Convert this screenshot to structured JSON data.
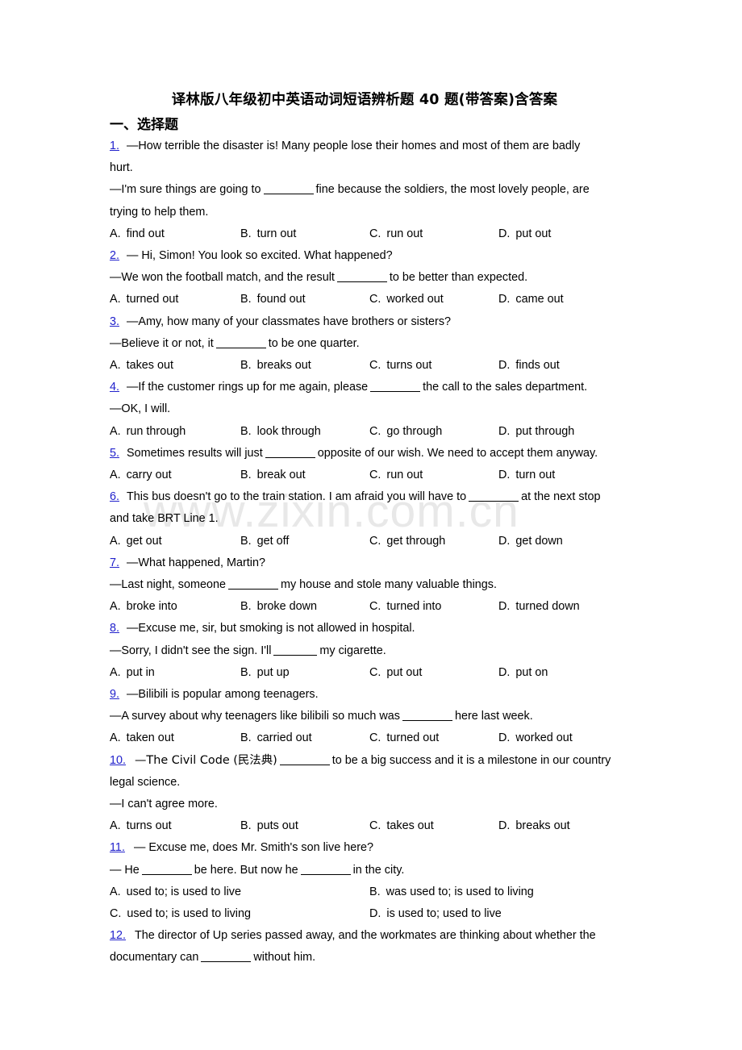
{
  "document": {
    "title": "译林版八年级初中英语动词短语辨析题 40 题(带答案)含答案",
    "section_heading": "一、选择题",
    "watermark": "www.zixin.com.cn"
  },
  "questions": [
    {
      "number": "1.",
      "lines": [
        "—How terrible the disaster is! Many people lose their homes and most of them are badly hurt.",
        "—I'm sure things are going to ________ fine because the soldiers, the most lovely people, are trying to help them."
      ],
      "stem_pre": "—I'm sure things are going to ",
      "stem_post": " fine because the soldiers, the most lovely people, are trying to help them.",
      "options_layout": "four",
      "options": [
        {
          "label": "A.",
          "text": "find out"
        },
        {
          "label": "B.",
          "text": "turn out"
        },
        {
          "label": "C.",
          "text": "run out"
        },
        {
          "label": "D.",
          "text": "put out"
        }
      ]
    },
    {
      "number": "2.",
      "lines": [
        "— Hi, Simon! You look so excited. What happened?",
        "—We won the football match, and the result ________ to be better than expected."
      ],
      "options_layout": "four",
      "options": [
        {
          "label": "A.",
          "text": "turned out"
        },
        {
          "label": "B.",
          "text": "found out"
        },
        {
          "label": "C.",
          "text": "worked out"
        },
        {
          "label": "D.",
          "text": "came out"
        }
      ]
    },
    {
      "number": "3.",
      "lines": [
        "—Amy, how many of your classmates have brothers or sisters?",
        "—Believe it or not, it ________ to be one quarter."
      ],
      "options_layout": "four",
      "options": [
        {
          "label": "A.",
          "text": "takes out"
        },
        {
          "label": "B.",
          "text": "breaks out"
        },
        {
          "label": "C.",
          "text": "turns out"
        },
        {
          "label": "D.",
          "text": "finds out"
        }
      ]
    },
    {
      "number": "4.",
      "lines": [
        "—If the customer rings up for me again, please ________ the call to the sales department.",
        "—OK, I will."
      ],
      "options_layout": "four",
      "options": [
        {
          "label": "A.",
          "text": "run through"
        },
        {
          "label": "B.",
          "text": "look through"
        },
        {
          "label": "C.",
          "text": "go through"
        },
        {
          "label": "D.",
          "text": "put through"
        }
      ]
    },
    {
      "number": "5.",
      "lines": [
        "Sometimes results will just ________ opposite of our wish. We need to accept them anyway."
      ],
      "options_layout": "four",
      "options": [
        {
          "label": "A.",
          "text": "carry out"
        },
        {
          "label": "B.",
          "text": "break out"
        },
        {
          "label": "C.",
          "text": "run out"
        },
        {
          "label": "D.",
          "text": "turn out"
        }
      ]
    },
    {
      "number": "6.",
      "lines": [
        "This bus doesn't go to the train station. I am afraid you will have to ________ at the next stop and take BRT Line 1."
      ],
      "options_layout": "four",
      "options": [
        {
          "label": "A.",
          "text": "get out"
        },
        {
          "label": "B.",
          "text": "get off"
        },
        {
          "label": "C.",
          "text": "get through"
        },
        {
          "label": "D.",
          "text": "get down"
        }
      ]
    },
    {
      "number": "7.",
      "lines": [
        "—What happened, Martin?",
        "—Last night, someone ________ my house and stole many valuable things."
      ],
      "options_layout": "four",
      "options": [
        {
          "label": "A.",
          "text": "broke into"
        },
        {
          "label": "B.",
          "text": "broke down"
        },
        {
          "label": "C.",
          "text": "turned into"
        },
        {
          "label": "D.",
          "text": "turned down"
        }
      ]
    },
    {
      "number": "8.",
      "lines": [
        "—Excuse me, sir, but smoking is not allowed in hospital.",
        "—Sorry, I didn't see the sign. I'll _______ my cigarette."
      ],
      "options_layout": "four",
      "options": [
        {
          "label": "A.",
          "text": "put in"
        },
        {
          "label": "B.",
          "text": "put up"
        },
        {
          "label": "C.",
          "text": "put out"
        },
        {
          "label": "D.",
          "text": "put on"
        }
      ]
    },
    {
      "number": "9.",
      "lines": [
        "—Bilibili is popular among teenagers.",
        "—A survey about why teenagers like bilibili so much was ________ here last week."
      ],
      "options_layout": "four",
      "options": [
        {
          "label": "A.",
          "text": "taken out"
        },
        {
          "label": "B.",
          "text": "carried out"
        },
        {
          "label": "C.",
          "text": "turned out"
        },
        {
          "label": "D.",
          "text": "worked out"
        }
      ]
    },
    {
      "number": "10.",
      "lines": [
        "—The Civil Code (民法典) ________ to be a big success and it is a milestone in our country legal science.",
        "—I can't agree more."
      ],
      "options_layout": "four",
      "options": [
        {
          "label": "A.",
          "text": "turns out"
        },
        {
          "label": "B.",
          "text": "puts out"
        },
        {
          "label": "C.",
          "text": "takes out"
        },
        {
          "label": "D.",
          "text": "breaks out"
        }
      ]
    },
    {
      "number": "11.",
      "lines": [
        "— Excuse me, does Mr. Smith's son live here?",
        "— He ________ be here. But now he ________ in the city."
      ],
      "options_layout": "two",
      "options": [
        {
          "label": "A.",
          "text": "used to; is used to live"
        },
        {
          "label": "B.",
          "text": "was used to; is used to living"
        },
        {
          "label": "C.",
          "text": "used to; is used to living"
        },
        {
          "label": "D.",
          "text": "is used to; used to live"
        }
      ]
    },
    {
      "number": "12.",
      "lines": [
        "The director of Up series passed away, and the workmates are thinking about whether the documentary can ________ without him."
      ],
      "options_layout": "none",
      "options": []
    }
  ],
  "text_fragments": {
    "q1_l1a": "—How terrible the disaster is! Many people lose their homes and most of them are badly",
    "q1_l1b": "hurt.",
    "q1_l2a": "—I'm sure things are going to",
    "q1_l2b": "fine because the soldiers, the most lovely people, are",
    "q1_l2c": "trying to help them.",
    "q2_l1": "— Hi, Simon! You look so excited. What happened?",
    "q2_l2a": "—We won the football match, and the result",
    "q2_l2b": "to be better than expected.",
    "q3_l1": "—Amy, how many of your classmates have brothers or sisters?",
    "q3_l2a": "—Believe it or not, it",
    "q3_l2b": "to be one quarter.",
    "q4_l1a": "—If the customer rings up for me again, please",
    "q4_l1b": "the call to the sales department.",
    "q4_l2": "—OK, I will.",
    "q5_l1a": "Sometimes results will just",
    "q5_l1b": "opposite of our wish. We need to accept them anyway.",
    "q6_l1a": "This bus doesn't go to the train station. I am afraid you will have to",
    "q6_l1b": "at the next stop",
    "q6_l2": "and take BRT Line 1.",
    "q7_l1": "—What happened, Martin?",
    "q7_l2a": "—Last night, someone",
    "q7_l2b": "my house and stole many valuable things.",
    "q8_l1": "—Excuse me, sir, but smoking is not allowed in hospital.",
    "q8_l2a": "—Sorry, I didn't see the sign. I'll",
    "q8_l2b": "my cigarette.",
    "q9_l1": "—Bilibili is popular among teenagers.",
    "q9_l2a": "—A survey about why teenagers like bilibili so much was",
    "q9_l2b": "here last week.",
    "q10_l1a": "—The Civil Code (民法典)",
    "q10_l1b": "to be a big success and it is a milestone in our country",
    "q10_l2": "legal science.",
    "q10_l3": "—I can't agree more.",
    "q11_l1": "— Excuse me, does Mr. Smith's son live here?",
    "q11_l2a": "— He",
    "q11_l2b": "be here. But now he",
    "q11_l2c": "in the city.",
    "q12_l1": "The director of Up series passed away, and the workmates are thinking about whether the",
    "q12_l2a": "documentary can",
    "q12_l2b": "without him."
  }
}
